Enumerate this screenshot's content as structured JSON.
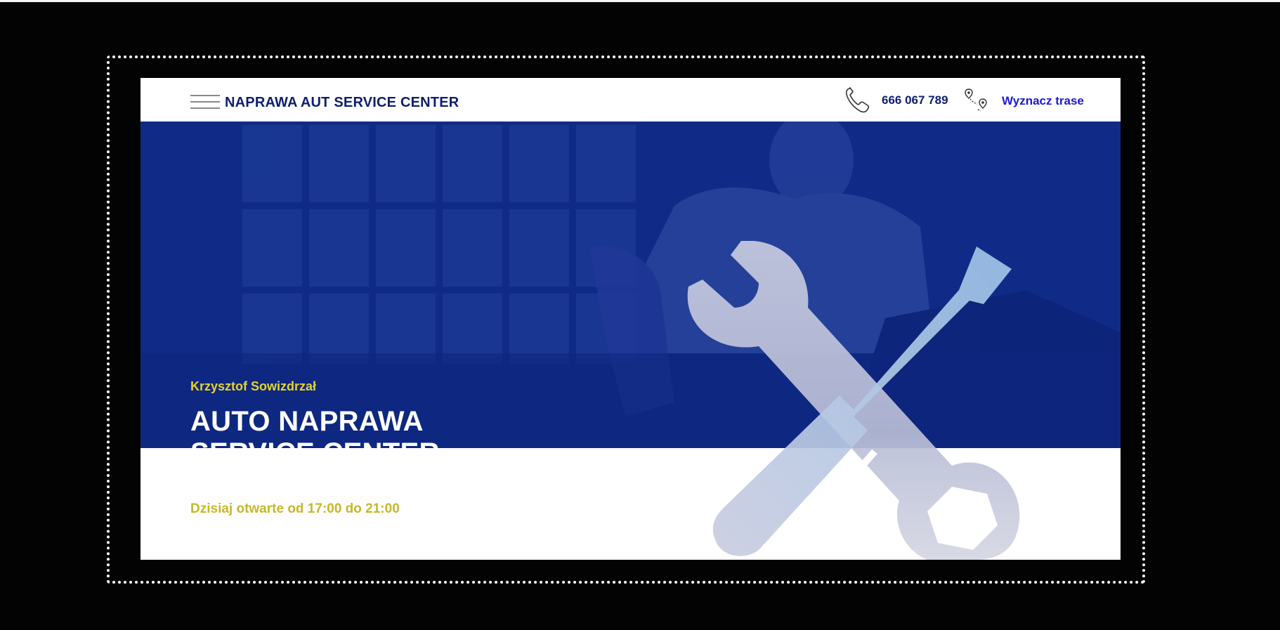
{
  "header": {
    "brand": "NAPRAWA AUT SERVICE CENTER",
    "phone": "666 067 789",
    "route_link": "Wyznacz trase"
  },
  "hero": {
    "owner": "Krzysztof Sowizdrzał",
    "title_line1": "AUTO NAPRAWA",
    "title_line2": "SERVICE CENTER"
  },
  "info": {
    "opening_hours": "Dzisiaj otwarte od 17:00 do 21:00"
  },
  "icons": {
    "menu": "hamburger-menu-icon",
    "phone": "phone-icon",
    "route": "route-map-icon",
    "tools": "wrench-screwdriver-icon"
  },
  "colors": {
    "brand_navy": "#0d1f6e",
    "hero_blue": "#0f2a86",
    "accent_yellow": "#e4d42a",
    "link_blue": "#1a1ad6"
  }
}
